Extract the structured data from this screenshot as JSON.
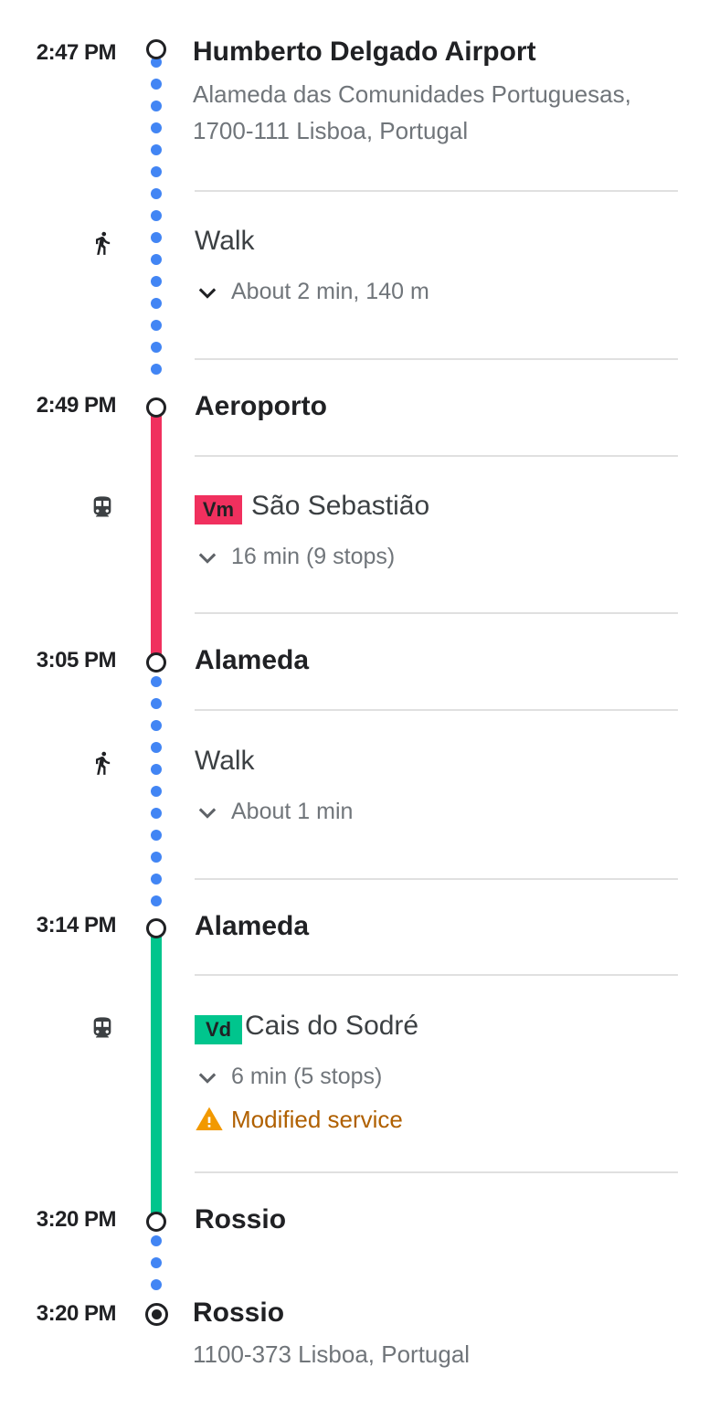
{
  "colors": {
    "walk_dots": "#4285f4",
    "red_line": "#f0305e",
    "green_line": "#00c58d",
    "alert": "#b06000",
    "alert_icon": "#f29900"
  },
  "stops": [
    {
      "time": "2:47 PM",
      "name": "Humberto Delgado Airport",
      "address_line1": "Alameda das Comunidades Portuguesas,",
      "address_line2": "1700-111 Lisboa, Portugal"
    },
    {
      "time": "2:49 PM",
      "name": "Aeroporto"
    },
    {
      "time": "3:05 PM",
      "name": "Alameda"
    },
    {
      "time": "3:14 PM",
      "name": "Alameda"
    },
    {
      "time": "3:20 PM",
      "name": "Rossio"
    },
    {
      "time": "3:20 PM",
      "name": "Rossio",
      "address_line1": "1100-373 Lisboa, Portugal"
    }
  ],
  "segments": [
    {
      "mode": "walk",
      "icon": "walk-icon",
      "title": "Walk",
      "detail": "About 2 min, 140 m"
    },
    {
      "mode": "metro",
      "icon": "metro-icon",
      "badge": "Vm",
      "title": "São Sebastião",
      "detail": "16 min (9 stops)"
    },
    {
      "mode": "walk",
      "icon": "walk-icon",
      "title": "Walk",
      "detail": "About 1 min"
    },
    {
      "mode": "metro",
      "icon": "metro-icon",
      "badge": "Vd",
      "title": "Cais do Sodré",
      "detail": "6 min (5 stops)",
      "alert": "Modified service"
    }
  ]
}
